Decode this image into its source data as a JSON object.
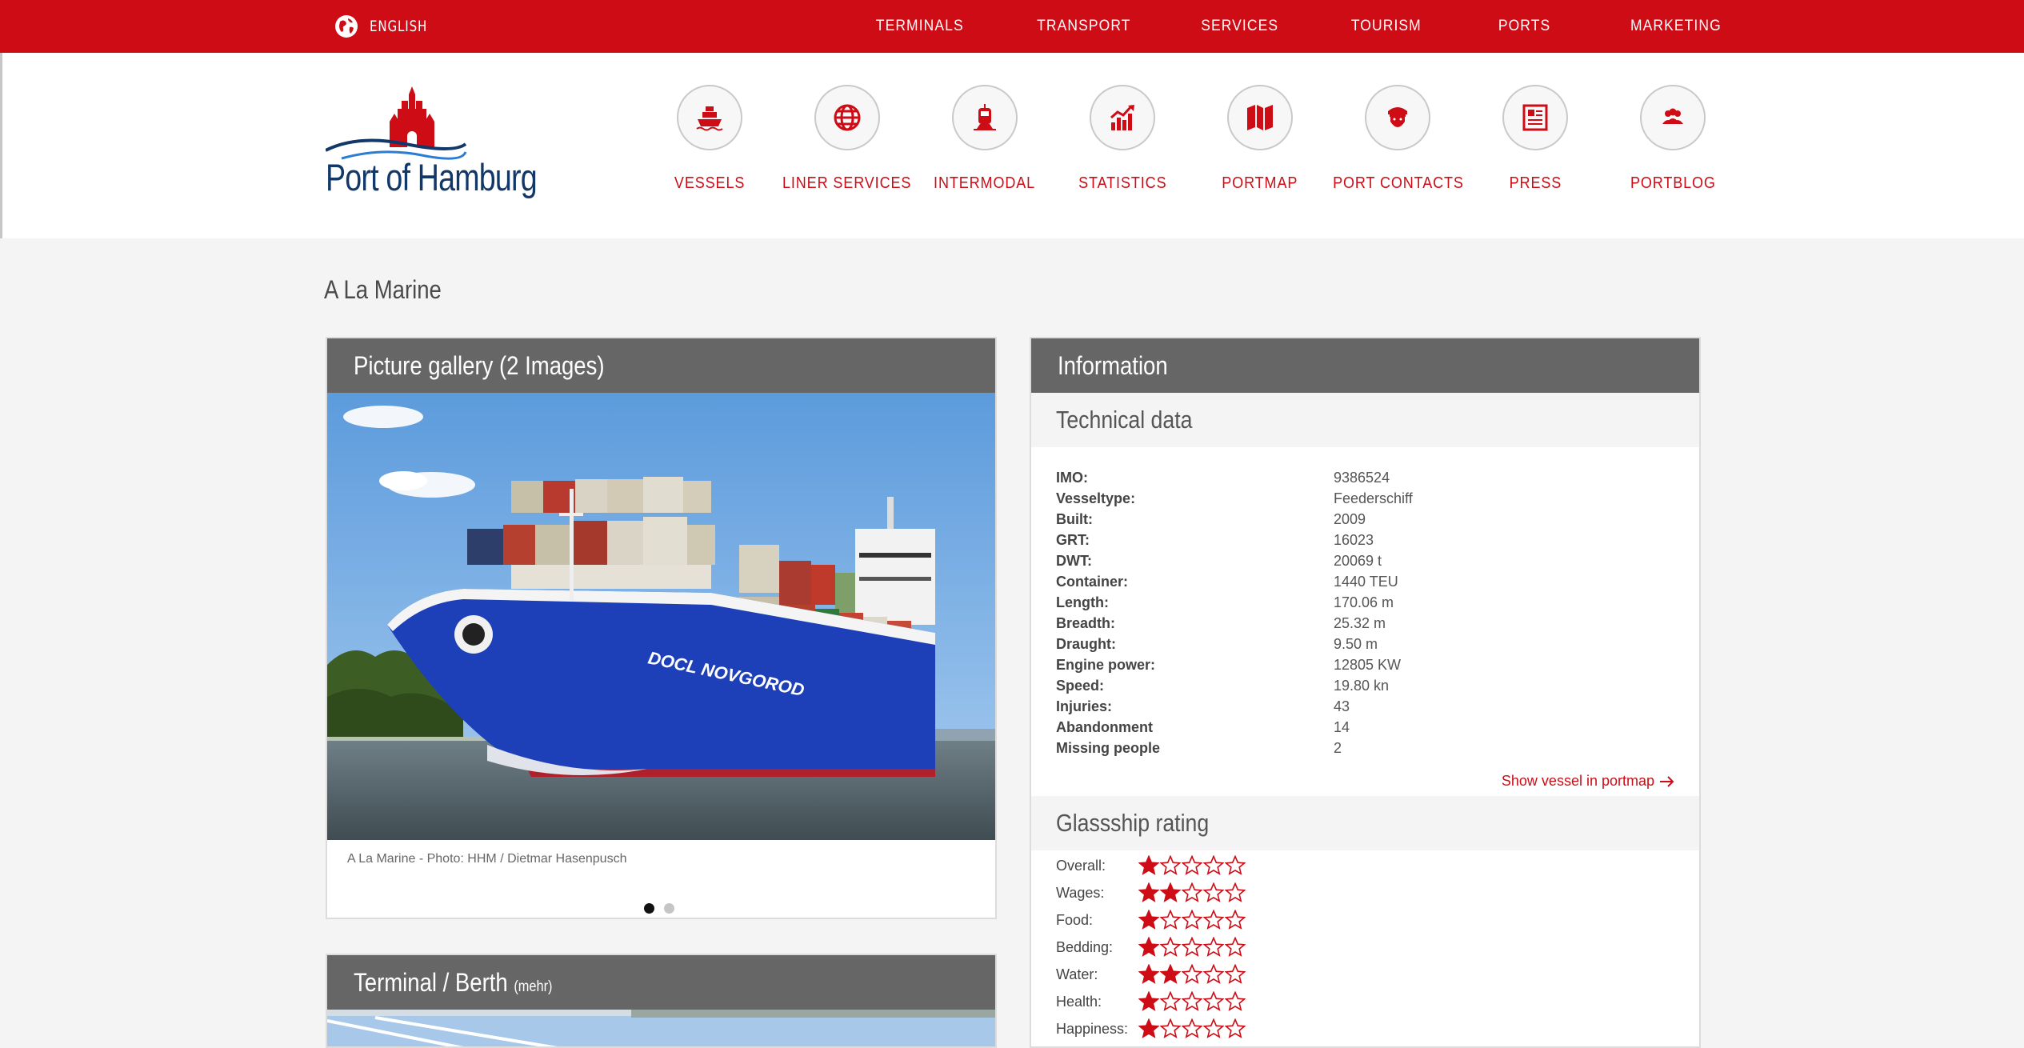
{
  "topbar": {
    "language": "ENGLISH",
    "nav": [
      "TERMINALS",
      "TRANSPORT",
      "SERVICES",
      "TOURISM",
      "PORTS",
      "MARKETING"
    ]
  },
  "header": {
    "logo_text": "Port of Hamburg",
    "quick_nav": [
      {
        "label": "VESSELS",
        "icon": "ship-icon"
      },
      {
        "label": "LINER SERVICES",
        "icon": "globe-icon"
      },
      {
        "label": "INTERMODAL",
        "icon": "train-icon"
      },
      {
        "label": "STATISTICS",
        "icon": "chart-icon"
      },
      {
        "label": "PORTMAP",
        "icon": "map-icon"
      },
      {
        "label": "PORT CONTACTS",
        "icon": "captain-icon"
      },
      {
        "label": "PRESS",
        "icon": "newspaper-icon"
      },
      {
        "label": "PORTBLOG",
        "icon": "people-icon"
      }
    ]
  },
  "page": {
    "title": "A La Marine"
  },
  "gallery": {
    "heading": "Picture gallery (2 Images)",
    "ship_name": "DOCL NOVGOROD",
    "caption": "A La Marine - Photo: HHM / Dietmar Hasenpusch",
    "slides": 2,
    "active_slide": 1
  },
  "terminal": {
    "heading": "Terminal / Berth",
    "more": "(mehr)"
  },
  "information": {
    "heading": "Information",
    "technical_heading": "Technical data",
    "technical": [
      {
        "k": "IMO:",
        "v": "9386524"
      },
      {
        "k": "Vesseltype:",
        "v": "Feederschiff"
      },
      {
        "k": "Built:",
        "v": "2009"
      },
      {
        "k": "GRT:",
        "v": "16023"
      },
      {
        "k": "DWT:",
        "v": "20069 t"
      },
      {
        "k": "Container:",
        "v": "1440 TEU"
      },
      {
        "k": "Length:",
        "v": "170.06 m"
      },
      {
        "k": "Breadth:",
        "v": "25.32 m"
      },
      {
        "k": "Draught:",
        "v": "9.50 m"
      },
      {
        "k": "Engine power:",
        "v": "12805 KW"
      },
      {
        "k": "Speed:",
        "v": "19.80 kn"
      },
      {
        "k": "Injuries:",
        "v": "43"
      },
      {
        "k": "Abandonment",
        "v": "14"
      },
      {
        "k": "Missing people",
        "v": "2"
      }
    ],
    "portmap_link": "Show vessel in portmap",
    "rating_heading": "Glassship rating",
    "rating_max": 5,
    "ratings": [
      {
        "k": "Overall:",
        "stars": 1
      },
      {
        "k": "Wages:",
        "stars": 2
      },
      {
        "k": "Food:",
        "stars": 1
      },
      {
        "k": "Bedding:",
        "stars": 1
      },
      {
        "k": "Water:",
        "stars": 2
      },
      {
        "k": "Health:",
        "stars": 1
      },
      {
        "k": "Happiness:",
        "stars": 1
      }
    ]
  },
  "colors": {
    "brand_red": "#cd0c16",
    "panel_grey": "#666666",
    "logo_blue": "#123769"
  }
}
